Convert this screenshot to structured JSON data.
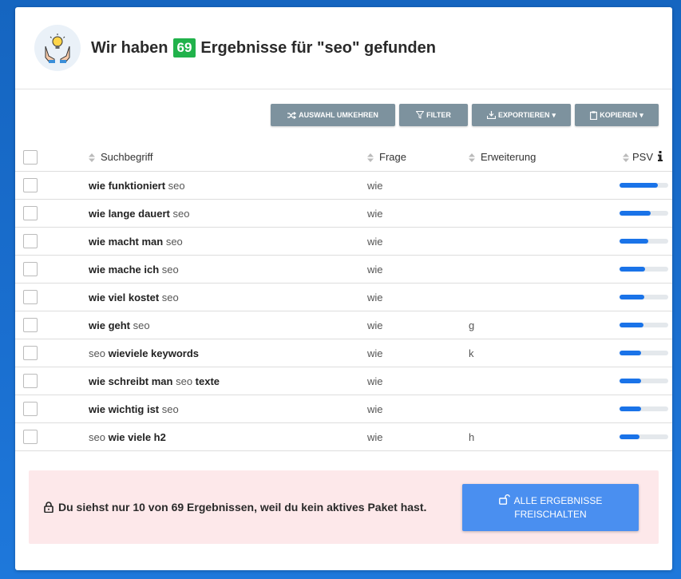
{
  "header": {
    "title_prefix": "Wir haben",
    "count": "69",
    "title_suffix": "Ergebnisse für \"seo\" gefunden"
  },
  "toolbar": {
    "invert_label": "AUSWAHL UMKEHREN",
    "filter_label": "FILTER",
    "export_label": "EXPORTIEREN",
    "copy_label": "KOPIEREN"
  },
  "table": {
    "headers": {
      "term": "Suchbegriff",
      "question": "Frage",
      "extension": "Erweiterung",
      "psv": "PSV"
    },
    "rows": [
      {
        "parts": [
          {
            "t": "wie funktioniert",
            "b": true
          },
          {
            "t": " seo",
            "b": false
          }
        ],
        "question": "wie",
        "extension": "",
        "psv": 0.78
      },
      {
        "parts": [
          {
            "t": "wie lange dauert",
            "b": true
          },
          {
            "t": " seo",
            "b": false
          }
        ],
        "question": "wie",
        "extension": "",
        "psv": 0.64
      },
      {
        "parts": [
          {
            "t": "wie macht man",
            "b": true
          },
          {
            "t": " seo",
            "b": false
          }
        ],
        "question": "wie",
        "extension": "",
        "psv": 0.59
      },
      {
        "parts": [
          {
            "t": "wie mache ich",
            "b": true
          },
          {
            "t": " seo",
            "b": false
          }
        ],
        "question": "wie",
        "extension": "",
        "psv": 0.52
      },
      {
        "parts": [
          {
            "t": "wie viel kostet",
            "b": true
          },
          {
            "t": " seo",
            "b": false
          }
        ],
        "question": "wie",
        "extension": "",
        "psv": 0.51
      },
      {
        "parts": [
          {
            "t": "wie geht",
            "b": true
          },
          {
            "t": " seo",
            "b": false
          }
        ],
        "question": "wie",
        "extension": "g",
        "psv": 0.49
      },
      {
        "parts": [
          {
            "t": "seo ",
            "b": false
          },
          {
            "t": "wieviele keywords",
            "b": true
          }
        ],
        "question": "wie",
        "extension": "k",
        "psv": 0.44
      },
      {
        "parts": [
          {
            "t": "wie schreibt man",
            "b": true
          },
          {
            "t": " seo ",
            "b": false
          },
          {
            "t": "texte",
            "b": true
          }
        ],
        "question": "wie",
        "extension": "",
        "psv": 0.44
      },
      {
        "parts": [
          {
            "t": "wie wichtig ist",
            "b": true
          },
          {
            "t": " seo",
            "b": false
          }
        ],
        "question": "wie",
        "extension": "",
        "psv": 0.44
      },
      {
        "parts": [
          {
            "t": "seo ",
            "b": false
          },
          {
            "t": "wie viele h2",
            "b": true
          }
        ],
        "question": "wie",
        "extension": "h",
        "psv": 0.41
      }
    ]
  },
  "notice": {
    "text": "Du siehst nur 10 von 69 Ergebnissen, weil du kein aktives Paket hast.",
    "button_line1": "ALLE ERGEBNISSE",
    "button_line2": "FREISCHALTEN"
  },
  "colors": {
    "badge": "#21b24b",
    "toolbar_button": "#7d929e",
    "bar_fill": "#1a73e8",
    "notice_bg": "#fde8ea",
    "unlock_button": "#4a8ff0"
  }
}
